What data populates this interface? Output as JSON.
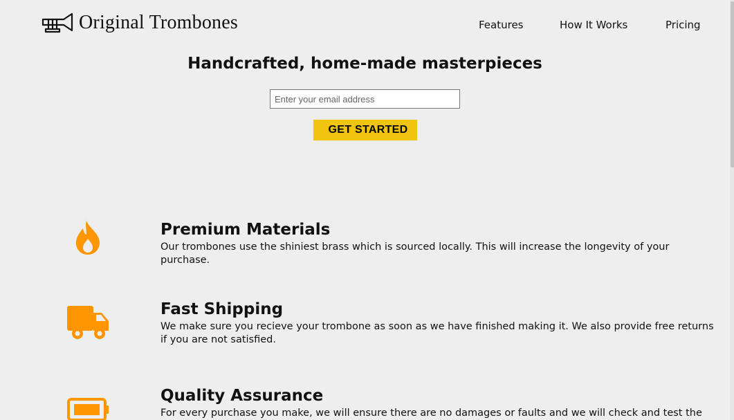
{
  "header": {
    "brand": "Original Trombones",
    "logo_icon": "trombone-icon",
    "nav": [
      {
        "label": "Features"
      },
      {
        "label": "How It Works"
      },
      {
        "label": "Pricing"
      }
    ]
  },
  "hero": {
    "title": "Handcrafted, home-made masterpieces",
    "email_placeholder": "Enter your email address",
    "email_value": "",
    "cta_label": "GET STARTED",
    "cta_color": "#f1c40f"
  },
  "features": [
    {
      "icon": "fire-icon",
      "title": "Premium Materials",
      "description": "Our trombones use the shiniest brass which is sourced locally. This will increase the longevity of your purchase."
    },
    {
      "icon": "truck-icon",
      "title": "Fast Shipping",
      "description": "We make sure you recieve your trombone as soon as we have finished making it. We also provide free returns if you are not satisfied."
    },
    {
      "icon": "battery-icon",
      "title": "Quality Assurance",
      "description": "For every purchase you make, we will ensure there are no damages or faults and we will check and test the pitch of"
    }
  ],
  "colors": {
    "background": "#eeeeee",
    "accent": "#ff9500",
    "button": "#f1c40f"
  }
}
